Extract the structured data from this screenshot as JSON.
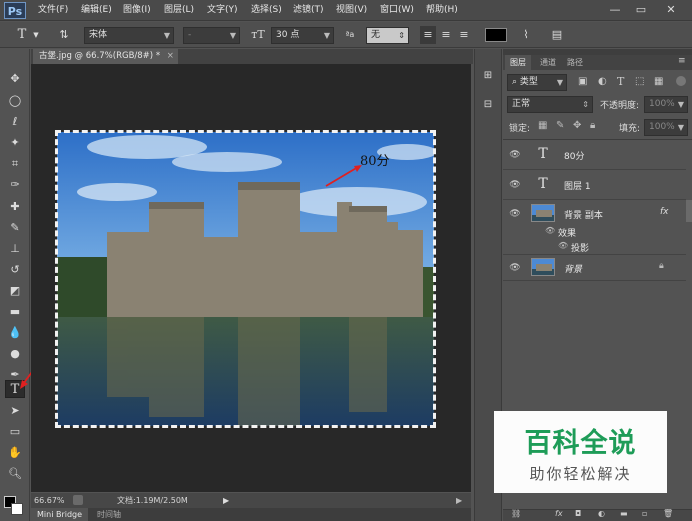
{
  "app": {
    "logo": "Ps"
  },
  "menu": [
    "文件(F)",
    "编辑(E)",
    "图像(I)",
    "图层(L)",
    "文字(Y)",
    "选择(S)",
    "滤镜(T)",
    "视图(V)",
    "窗口(W)",
    "帮助(H)"
  ],
  "window_controls": {
    "minimize": "—",
    "restore": "▭",
    "close": "✕"
  },
  "options": {
    "tool_icon": "T",
    "font_family": "宋体",
    "font_style": "-",
    "font_size": "30 点",
    "aa_label": "ªa",
    "aa_mode": "无",
    "text_color": "#000000"
  },
  "document": {
    "tab_label": "古堡.jpg @ 66.7%(RGB/8#) *",
    "overlay_text": "80分",
    "zoom": "66.67%",
    "doc_info": "文档:1.19M/2.50M"
  },
  "bottom_tabs": [
    "Mini Bridge",
    "时间轴"
  ],
  "panel_tabs": [
    "图层",
    "通道",
    "路径"
  ],
  "layers_panel": {
    "filter_kind": "类型",
    "blend_mode": "正常",
    "opacity_label": "不透明度:",
    "opacity_value": "100%",
    "lock_label": "锁定:",
    "fill_label": "填充:",
    "fill_value": "100%",
    "fx_label": "fx",
    "layers": [
      {
        "name": "80分",
        "type": "text"
      },
      {
        "name": "图层 1",
        "type": "text"
      },
      {
        "name": "背景 副本",
        "type": "image",
        "effects_label": "效果",
        "effect": "投影"
      },
      {
        "name": "背景",
        "type": "image"
      }
    ]
  },
  "watermark": {
    "title": "百科全说",
    "subtitle": "助你轻松解决"
  },
  "colors": {
    "accent_green": "#1e9c58",
    "ps_blue": "#9dc8f5"
  }
}
